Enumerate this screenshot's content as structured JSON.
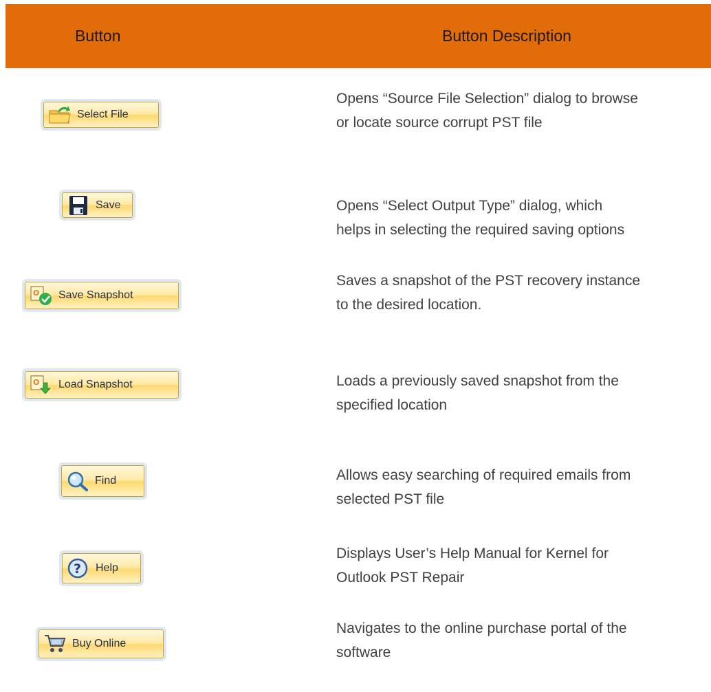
{
  "header": {
    "col1": "Button",
    "col2": "Button Description"
  },
  "rows": [
    {
      "label": "Select File",
      "icon": "open-folder-icon",
      "description": "Opens “Source File Selection” dialog to browse\nor locate source corrupt PST file"
    },
    {
      "label": "Save",
      "icon": "floppy-disk-icon",
      "description": "Opens “Select Output Type” dialog, which\nhelps in selecting the required saving options"
    },
    {
      "label": "Save Snapshot",
      "icon": "snapshot-check-icon",
      "description": "Saves a snapshot of the PST recovery instance\nto the desired location."
    },
    {
      "label": "Load Snapshot",
      "icon": "snapshot-load-icon",
      "description": "Loads a previously saved snapshot from the\nspecified location"
    },
    {
      "label": "Find",
      "icon": "magnifier-icon",
      "description": "Allows easy searching of  required emails from\nselected PST file"
    },
    {
      "label": "Help",
      "icon": "help-icon",
      "description": "Displays User’s Help Manual for Kernel for\nOutlook PST Repair"
    },
    {
      "label": "Buy Online",
      "icon": "shopping-cart-icon",
      "description": "Navigates to the online purchase portal of the\nsoftware"
    }
  ],
  "colors": {
    "header_bg": "#e36c0a",
    "button_gradient": "#ffe9a3"
  }
}
